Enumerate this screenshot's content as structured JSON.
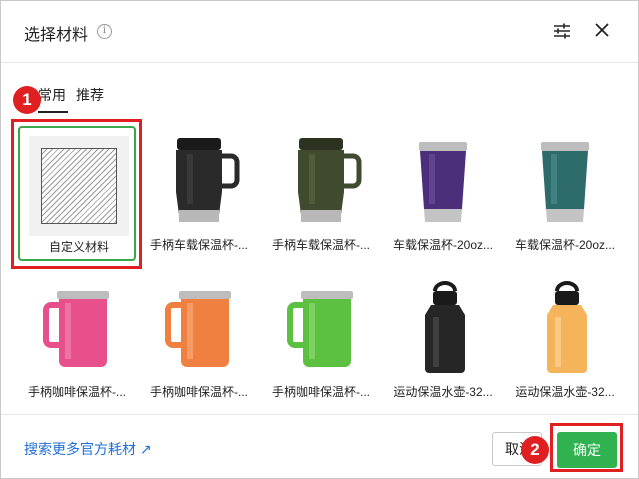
{
  "dialog": {
    "title": "选择材料",
    "info_icon": "info-icon",
    "filter_icon": "sliders-icon",
    "close_icon": "close-icon"
  },
  "tabs": [
    {
      "label": "常用",
      "active": true
    },
    {
      "label": "推荐",
      "active": false
    }
  ],
  "materials": [
    {
      "label": "自定义材料",
      "kind": "custom",
      "selected": true
    },
    {
      "label": "手柄车载保温杯-...",
      "kind": "mug",
      "color": "#2a2a2a"
    },
    {
      "label": "手柄车载保温杯-...",
      "kind": "mug",
      "color": "#3f4a2e"
    },
    {
      "label": "车载保温杯-20oz...",
      "kind": "tumbler",
      "color": "#4b2f7a"
    },
    {
      "label": "车载保温杯-20oz...",
      "kind": "tumbler",
      "color": "#2e6b6b"
    },
    {
      "label": "手柄咖啡保温杯-...",
      "kind": "coffee",
      "color": "#e8508c"
    },
    {
      "label": "手柄咖啡保温杯-...",
      "kind": "coffee",
      "color": "#f08040"
    },
    {
      "label": "手柄咖啡保温杯-...",
      "kind": "coffee",
      "color": "#5cc040"
    },
    {
      "label": "运动保温水壶-32...",
      "kind": "bottle",
      "color": "#262626"
    },
    {
      "label": "运动保温水壶-32...",
      "kind": "bottle",
      "color": "#f6b45a"
    }
  ],
  "footer": {
    "search_link": "搜索更多官方耗材",
    "cancel_label": "取消",
    "confirm_label": "确定"
  },
  "markers": {
    "first": "1",
    "second": "2"
  },
  "colors": {
    "accent_green": "#2fb24f",
    "link_blue": "#1f6fd6",
    "highlight_red": "#e02020"
  }
}
